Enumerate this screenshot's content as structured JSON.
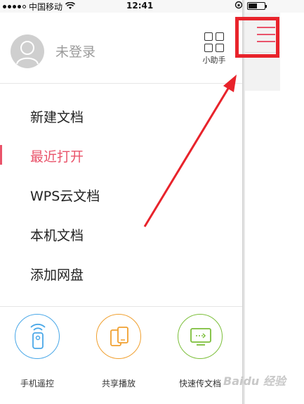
{
  "status_bar": {
    "carrier": "中国移动",
    "time": "12:41"
  },
  "profile": {
    "login_status": "未登录",
    "assistant_label": "小助手"
  },
  "menu": [
    {
      "label": "新建文档",
      "active": false
    },
    {
      "label": "最近打开",
      "active": true
    },
    {
      "label": "WPS云文档",
      "active": false
    },
    {
      "label": "本机文档",
      "active": false
    },
    {
      "label": "添加网盘",
      "active": false
    }
  ],
  "tools": [
    {
      "label": "手机遥控",
      "icon": "remote-control-icon",
      "color": "#4aa8e8"
    },
    {
      "label": "共享播放",
      "icon": "share-play-icon",
      "color": "#f0a030"
    },
    {
      "label": "快速传文档",
      "icon": "fast-transfer-icon",
      "color": "#7cbf3a"
    }
  ],
  "colors": {
    "accent": "#e9536a",
    "annotation": "#e8232b"
  },
  "watermark": "Baidu 经验"
}
